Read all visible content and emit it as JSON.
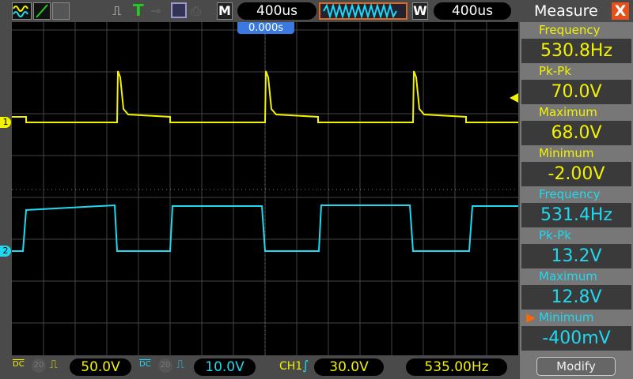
{
  "toolbar": {
    "timebase": "400us",
    "mode_badge": "M",
    "window_badge": "W",
    "window_timebase": "400us",
    "trigger_badge": "T"
  },
  "screen": {
    "trigger_position": "0.000s",
    "ch1_marker": "1",
    "ch2_marker": "2"
  },
  "measure": {
    "title": "Measure",
    "close": "X",
    "items": [
      {
        "label": "Frequency",
        "value": "530.8Hz"
      },
      {
        "label": "Pk-Pk",
        "value": "70.0V"
      },
      {
        "label": "Maximum",
        "value": "68.0V"
      },
      {
        "label": "Minimum",
        "value": "-2.00V"
      },
      {
        "label": "Frequency",
        "value": "531.4Hz"
      },
      {
        "label": "Pk-Pk",
        "value": "13.2V"
      },
      {
        "label": "Maximum",
        "value": "12.8V"
      },
      {
        "label": "Minimum",
        "value": "-400mV"
      }
    ],
    "modify": "Modify"
  },
  "bottom": {
    "ch1_coupling": "DC",
    "ch1_bw": "20",
    "ch1_scale": "50.0V",
    "ch2_coupling": "DC",
    "ch2_bw": "20",
    "ch2_scale": "10.0V",
    "trig_source": "CH1",
    "trig_level": "30.0V",
    "trig_freq": "535.00Hz"
  },
  "colors": {
    "ch1": "#f2f200",
    "ch2": "#20d8f0"
  }
}
